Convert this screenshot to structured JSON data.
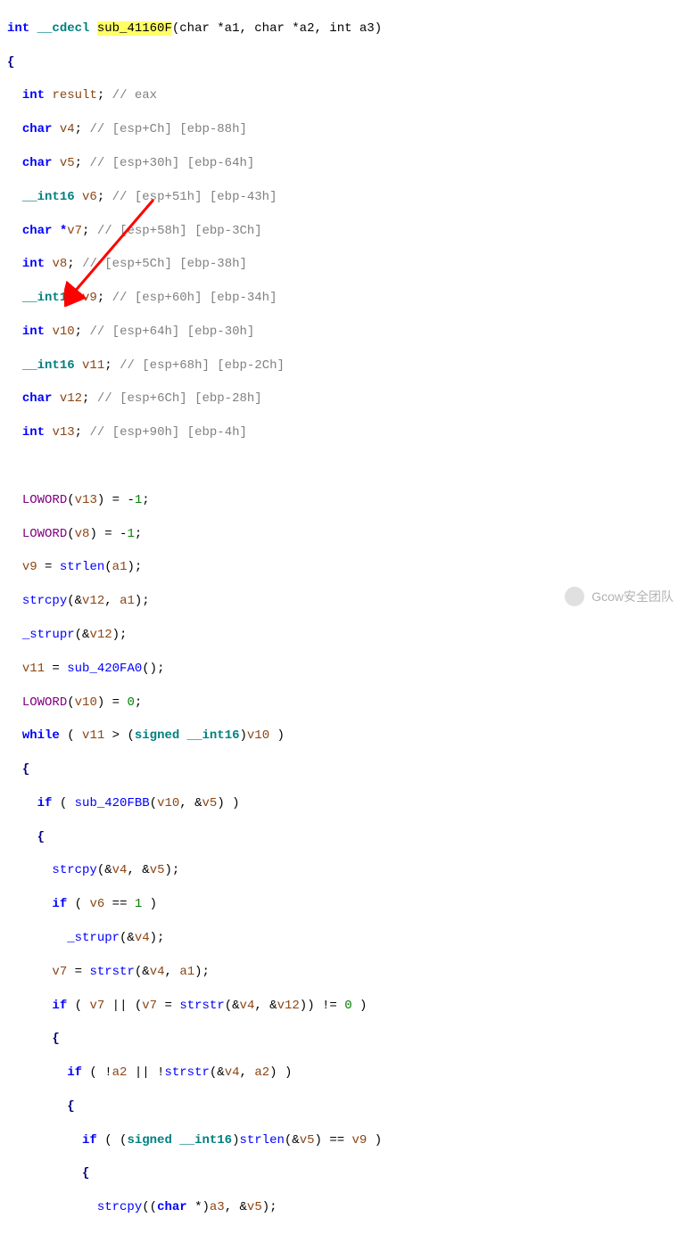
{
  "signature": {
    "ret_type": "int",
    "cc": "__cdecl",
    "name": "sub_41160F",
    "params": "(char *a1, char *a2, int a3)"
  },
  "decl": [
    {
      "t": "int",
      "v": "result",
      "c": "// eax"
    },
    {
      "t": "char",
      "v": "v4",
      "c": "// [esp+Ch] [ebp-88h]"
    },
    {
      "t": "char",
      "v": "v5",
      "c": "// [esp+30h] [ebp-64h]"
    },
    {
      "t": "__int16",
      "v": "v6",
      "c": "// [esp+51h] [ebp-43h]"
    },
    {
      "t": "char *",
      "v": "v7",
      "c": "// [esp+58h] [ebp-3Ch]"
    },
    {
      "t": "int",
      "v": "v8",
      "c": "// [esp+5Ch] [ebp-38h]"
    },
    {
      "t": "__int16",
      "v": "v9",
      "c": "// [esp+60h] [ebp-34h]"
    },
    {
      "t": "int",
      "v": "v10",
      "c": "// [esp+64h] [ebp-30h]"
    },
    {
      "t": "__int16",
      "v": "v11",
      "c": "// [esp+68h] [ebp-2Ch]"
    },
    {
      "t": "char",
      "v": "v12",
      "c": "// [esp+6Ch] [ebp-28h]"
    },
    {
      "t": "int",
      "v": "v13",
      "c": "// [esp+90h] [ebp-4h]"
    }
  ],
  "body": [
    "LOWORD(v13) = -1;",
    "LOWORD(v8) = -1;",
    "v9 = strlen(a1);",
    "strcpy(&v12, a1);",
    "_strupr(&v12);",
    "v11 = sub_420FA0();",
    "LOWORD(v10) = 0;",
    "while ( v11 > (signed __int16)v10 )",
    "{",
    "  if ( sub_420FBB(v10, &v5) )",
    "  {",
    "    strcpy(&v4, &v5);",
    "    if ( v6 == 1 )",
    "      _strupr(&v4);",
    "    v7 = strstr(&v4, a1);",
    "    if ( v7 || (v7 = strstr(&v4, &v12)) != 0 )",
    "    {",
    "      if ( !a2 || !strstr(&v4, a2) )",
    "      {",
    "        if ( (signed __int16)strlen(&v5) == v9 )",
    "        {",
    "          strcpy((char *)a3, &v5);"
  ],
  "footer": "Gcow安全团队"
}
